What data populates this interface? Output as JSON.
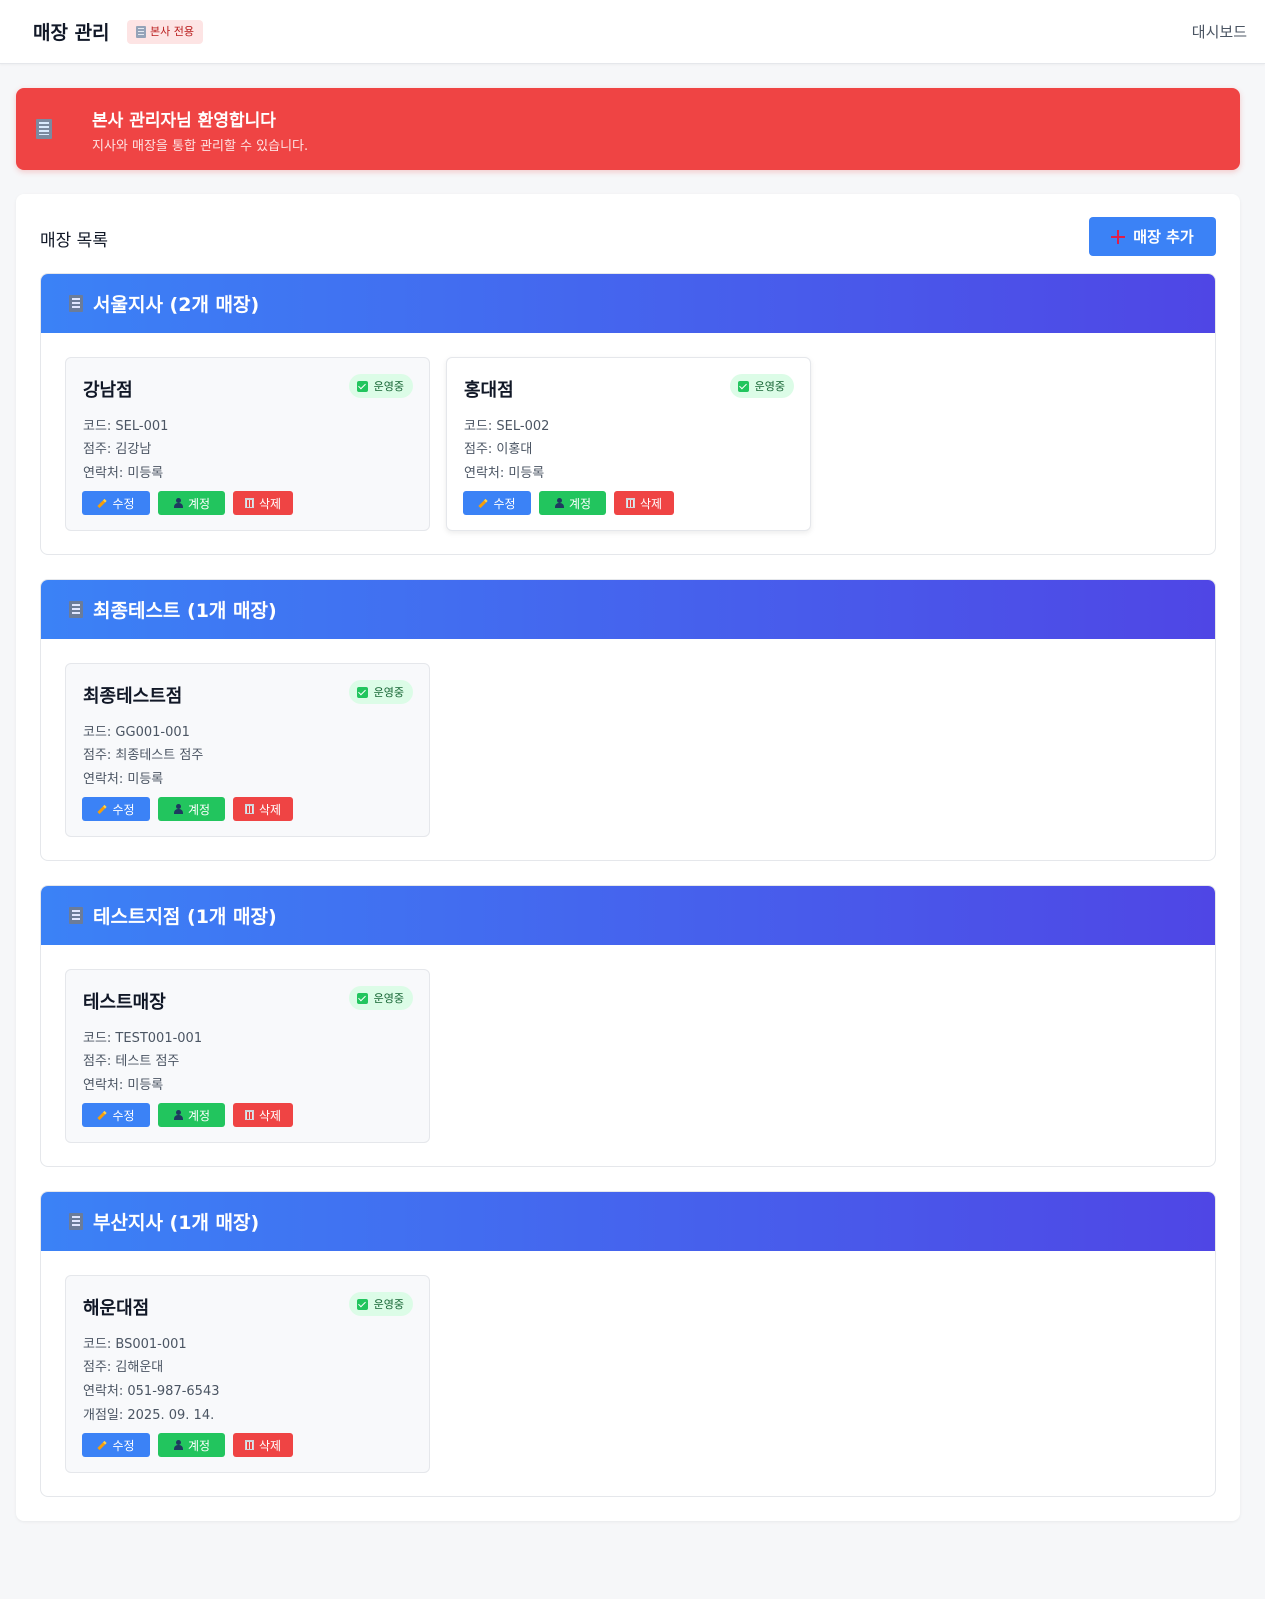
{
  "header": {
    "title": "매장 관리",
    "hq_badge": "본사 전용",
    "dashboard_link": "대시보드"
  },
  "welcome": {
    "title": "본사 관리자님 환영합니다",
    "subtitle": "지사와 매장을 통합 관리할 수 있습니다."
  },
  "store_list": {
    "title": "매장 목록",
    "add_button": "매장 추가"
  },
  "labels": {
    "edit": "수정",
    "account": "계정",
    "delete": "삭제",
    "status_active": "운영중"
  },
  "branches": [
    {
      "header": "서울지사 (2개 매장)",
      "stores": [
        {
          "name": "강남점",
          "status": "운영중",
          "code": "코드: SEL-001",
          "owner": "점주: 김강남",
          "contact": "연락처: 미등록"
        },
        {
          "name": "홍대점",
          "status": "운영중",
          "code": "코드: SEL-002",
          "owner": "점주: 이홍대",
          "contact": "연락처: 미등록"
        }
      ]
    },
    {
      "header": "최종테스트 (1개 매장)",
      "stores": [
        {
          "name": "최종테스트점",
          "status": "운영중",
          "code": "코드: GG001-001",
          "owner": "점주: 최종테스트 점주",
          "contact": "연락처: 미등록"
        }
      ]
    },
    {
      "header": "테스트지점 (1개 매장)",
      "stores": [
        {
          "name": "테스트매장",
          "status": "운영중",
          "code": "코드: TEST001-001",
          "owner": "점주: 테스트 점주",
          "contact": "연락처: 미등록"
        }
      ]
    },
    {
      "header": "부산지사 (1개 매장)",
      "stores": [
        {
          "name": "해운대점",
          "status": "운영중",
          "code": "코드: BS001-001",
          "owner": "점주: 김해운대",
          "contact": "연락처: 051-987-6543",
          "opened": "개점일: 2025. 09. 14."
        }
      ]
    }
  ],
  "colors": {
    "primary": "#3b82f6",
    "success": "#22c55e",
    "danger": "#ef4444",
    "gradient_end": "#4f46e5"
  }
}
